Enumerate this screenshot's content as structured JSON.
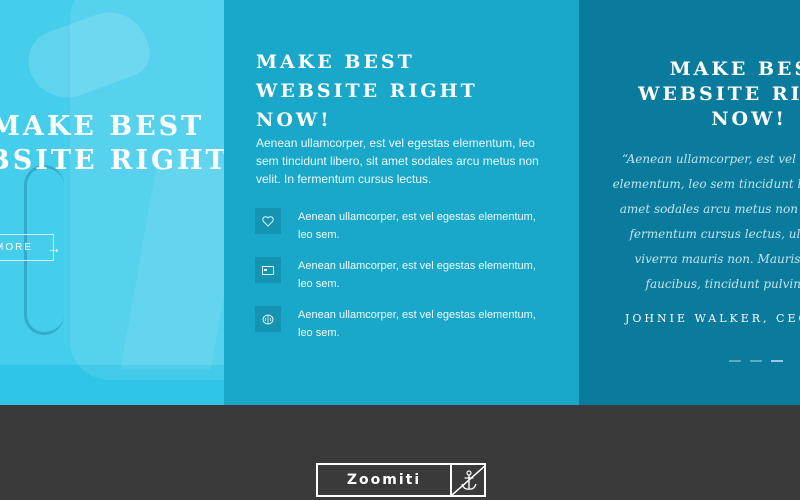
{
  "hero": {
    "title_line1": "MAKE BEST",
    "title_line2": "WEBSITE RIGHT",
    "button_label": "MORE",
    "button_icon": "arrow-right-icon"
  },
  "features_panel": {
    "title_line1": "MAKE BEST",
    "title_line2": "WEBSITE RIGHT",
    "title_line3": "NOW!",
    "text": "Aenean ullamcorper, est vel egestas elementum, leo sem tincidunt libero, sit amet sodales arcu metus non velit. In fermentum cursus lectus.",
    "items": [
      {
        "icon": "heart-icon",
        "text": "Aenean ullamcorper, est vel egestas elementum, leo sem."
      },
      {
        "icon": "card-icon",
        "text": "Aenean ullamcorper, est vel egestas elementum, leo sem."
      },
      {
        "icon": "brain-icon",
        "text": "Aenean ullamcorper, est vel egestas elementum, leo sem."
      }
    ]
  },
  "testimonial_panel": {
    "title_line1": "MAKE BEST",
    "title_line2": "WEBSITE RIGHT",
    "title_line3": "NOW!",
    "quote": "“Aenean ullamcorper, est vel egestas elementum, leo sem tincidunt libero, sit amet sodales arcu metus non velit. In fermentum cursus lectus, ultricies viverra mauris non. Mauris id ex faucibus, tincidunt pulvinar.”",
    "author": "JOHNIE WALKER, CEO"
  },
  "footer": {
    "logo_text": "Zoomiti",
    "logo_icon": "anchor-icon"
  },
  "colors": {
    "panel1": "#2ec5e7",
    "panel2": "#19a8c9",
    "panel3": "#0b7b9d",
    "footer": "#3a3a3a"
  }
}
